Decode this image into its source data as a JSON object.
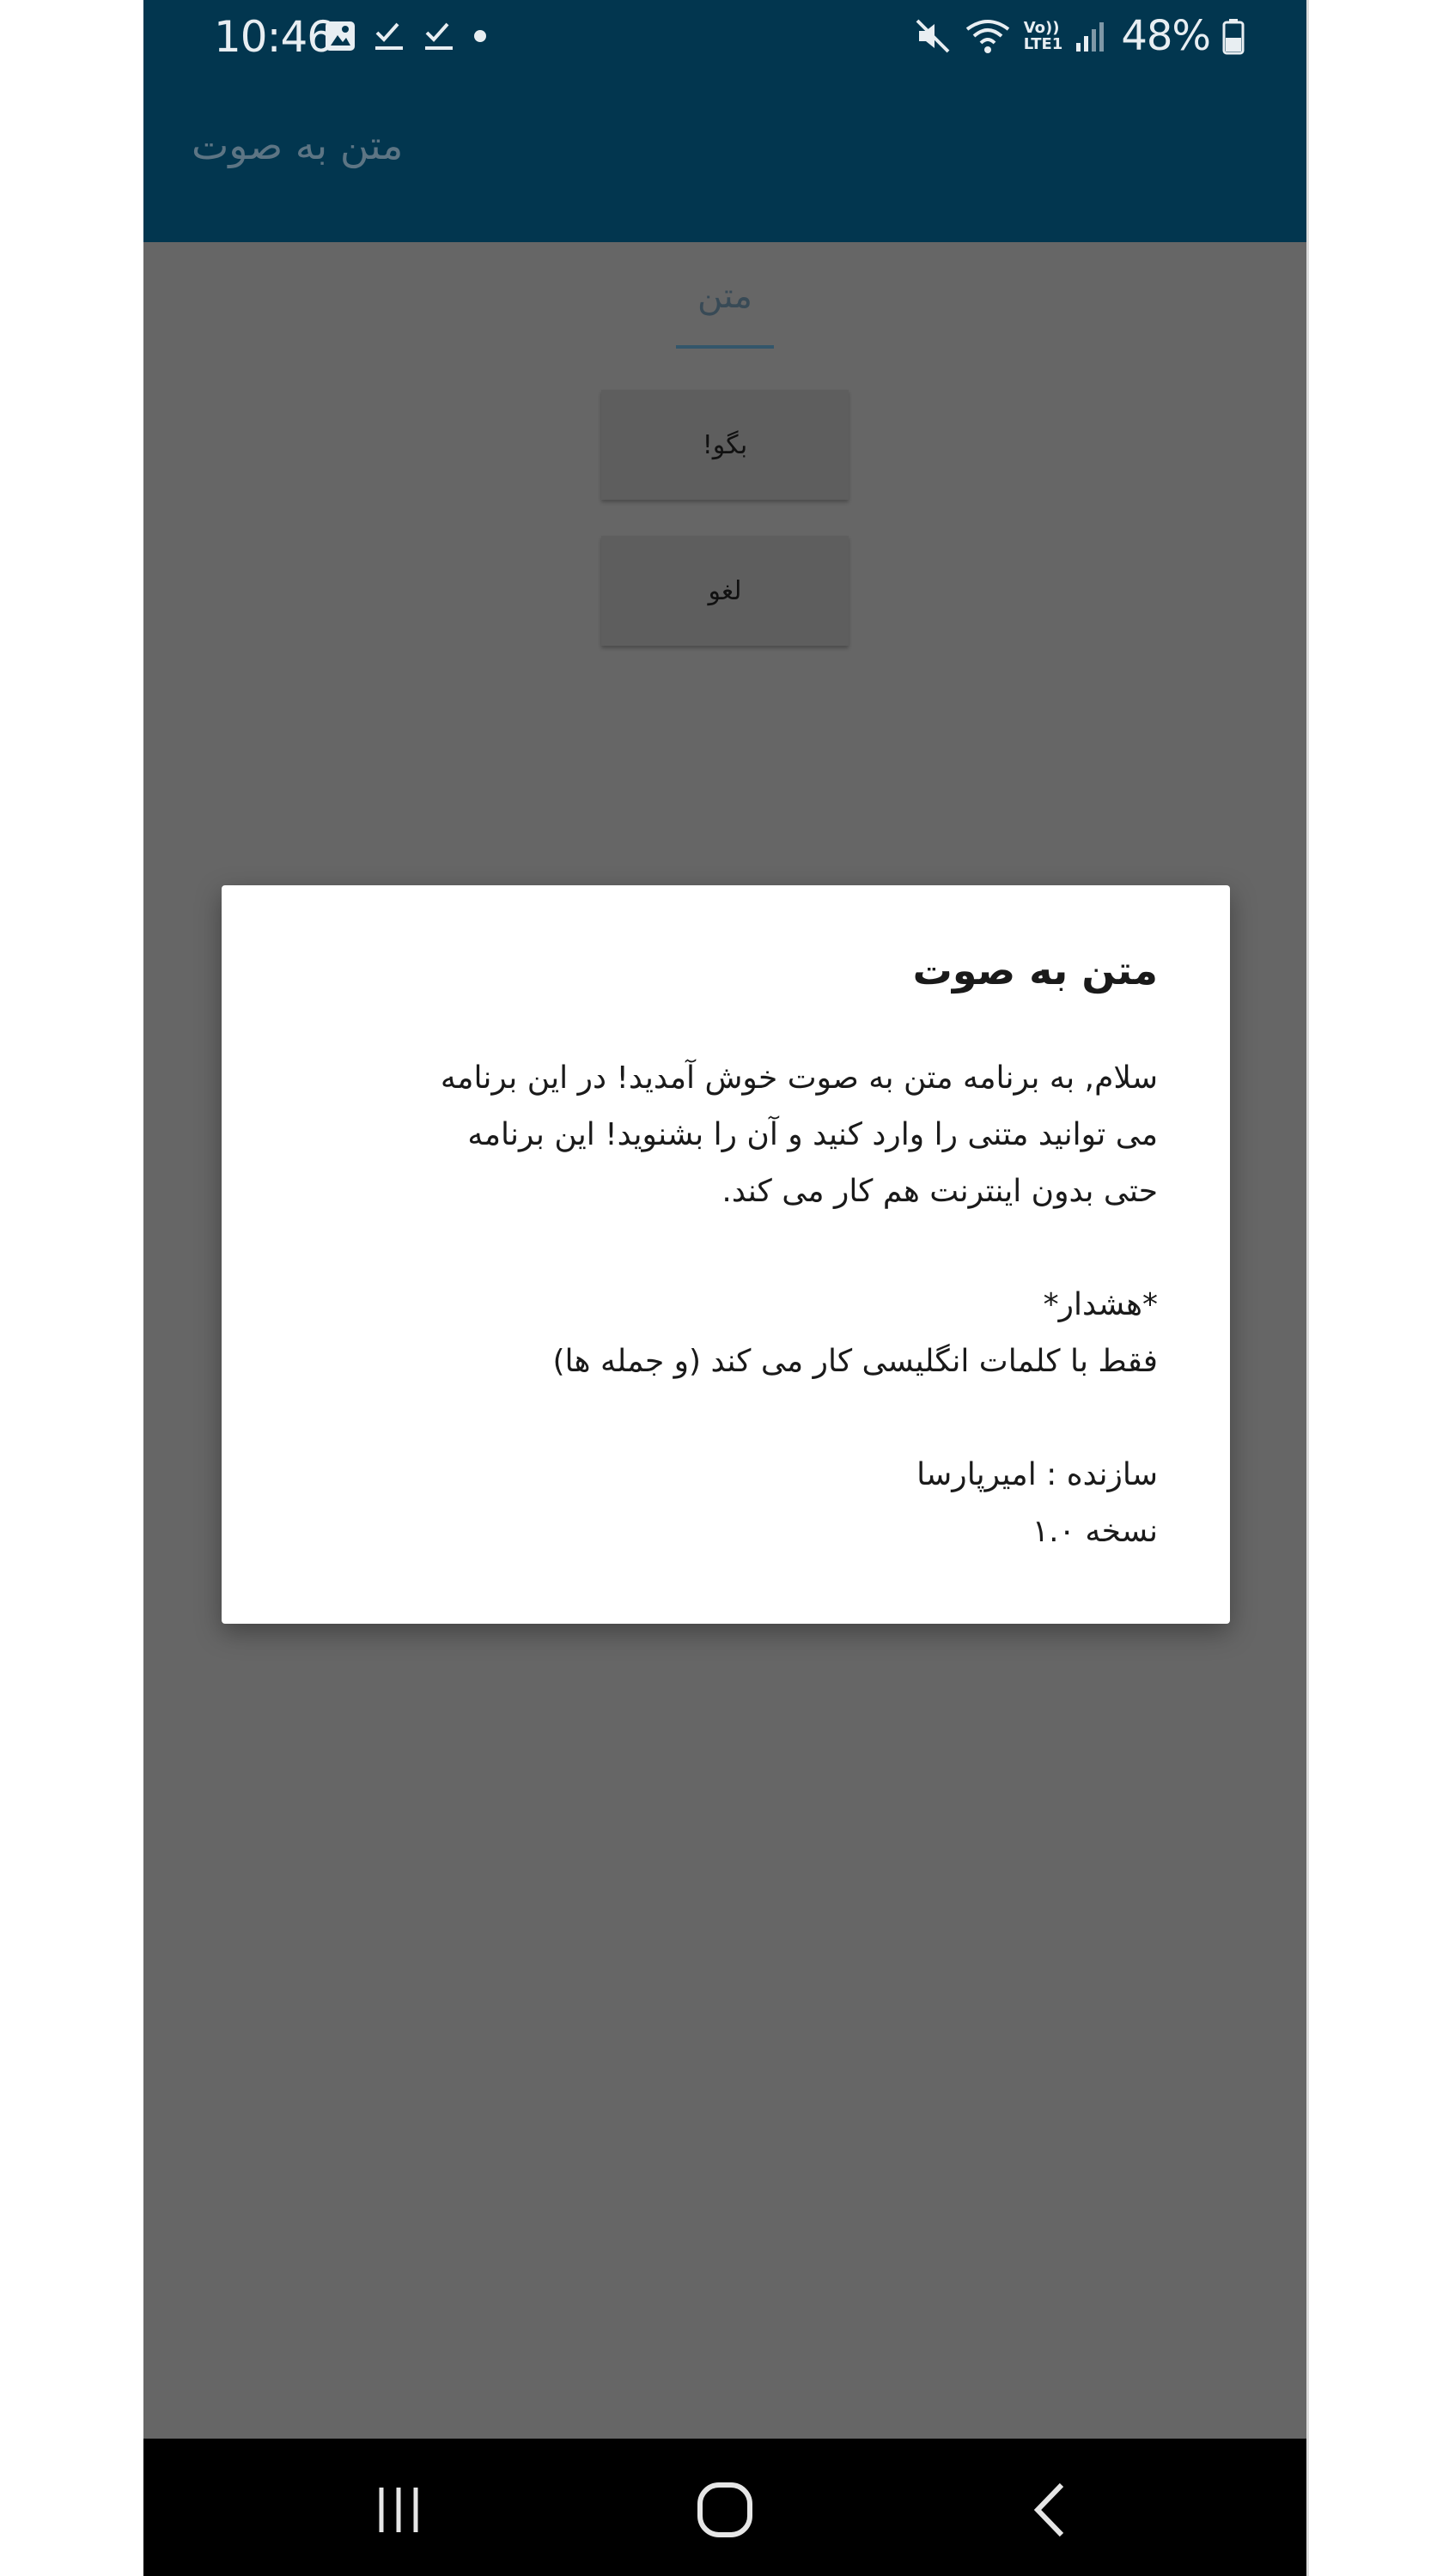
{
  "status_bar": {
    "time": "10:46",
    "battery": "48%",
    "icons_left": [
      "gallery-icon",
      "check-icon",
      "check-icon",
      "dot-icon"
    ],
    "icons_right": [
      "mute-icon",
      "wifi-icon",
      "volte-icon",
      "signal-icon",
      "battery-icon"
    ],
    "volte_label_top": "Vo))",
    "volte_label_bottom": "LTE1"
  },
  "app_bar": {
    "title": "متن به صوت"
  },
  "main": {
    "tab_label": "متن",
    "say_button": "بگو!",
    "cancel_button": "لغو"
  },
  "dialog": {
    "title": "متن به صوت",
    "lines": [
      "سلام, به برنامه متن به صوت خوش آمدید! در این برنامه",
      "می توانید متنی را وارد کنید و آن را بشنوید! این برنامه",
      "حتی بدون اینترنت هم کار می کند."
    ],
    "warning_title": "*هشدار*",
    "warning_text": "فقط با کلمات انگلیسی کار می کند (و جمله ها)",
    "author": "سازنده : امیرپارسا",
    "version": "نسخه ۱.۰"
  },
  "colors": {
    "app_bar": "#02364f",
    "scrim": "#666666",
    "dialog": "#ffffff",
    "nav_bar": "#000000"
  }
}
